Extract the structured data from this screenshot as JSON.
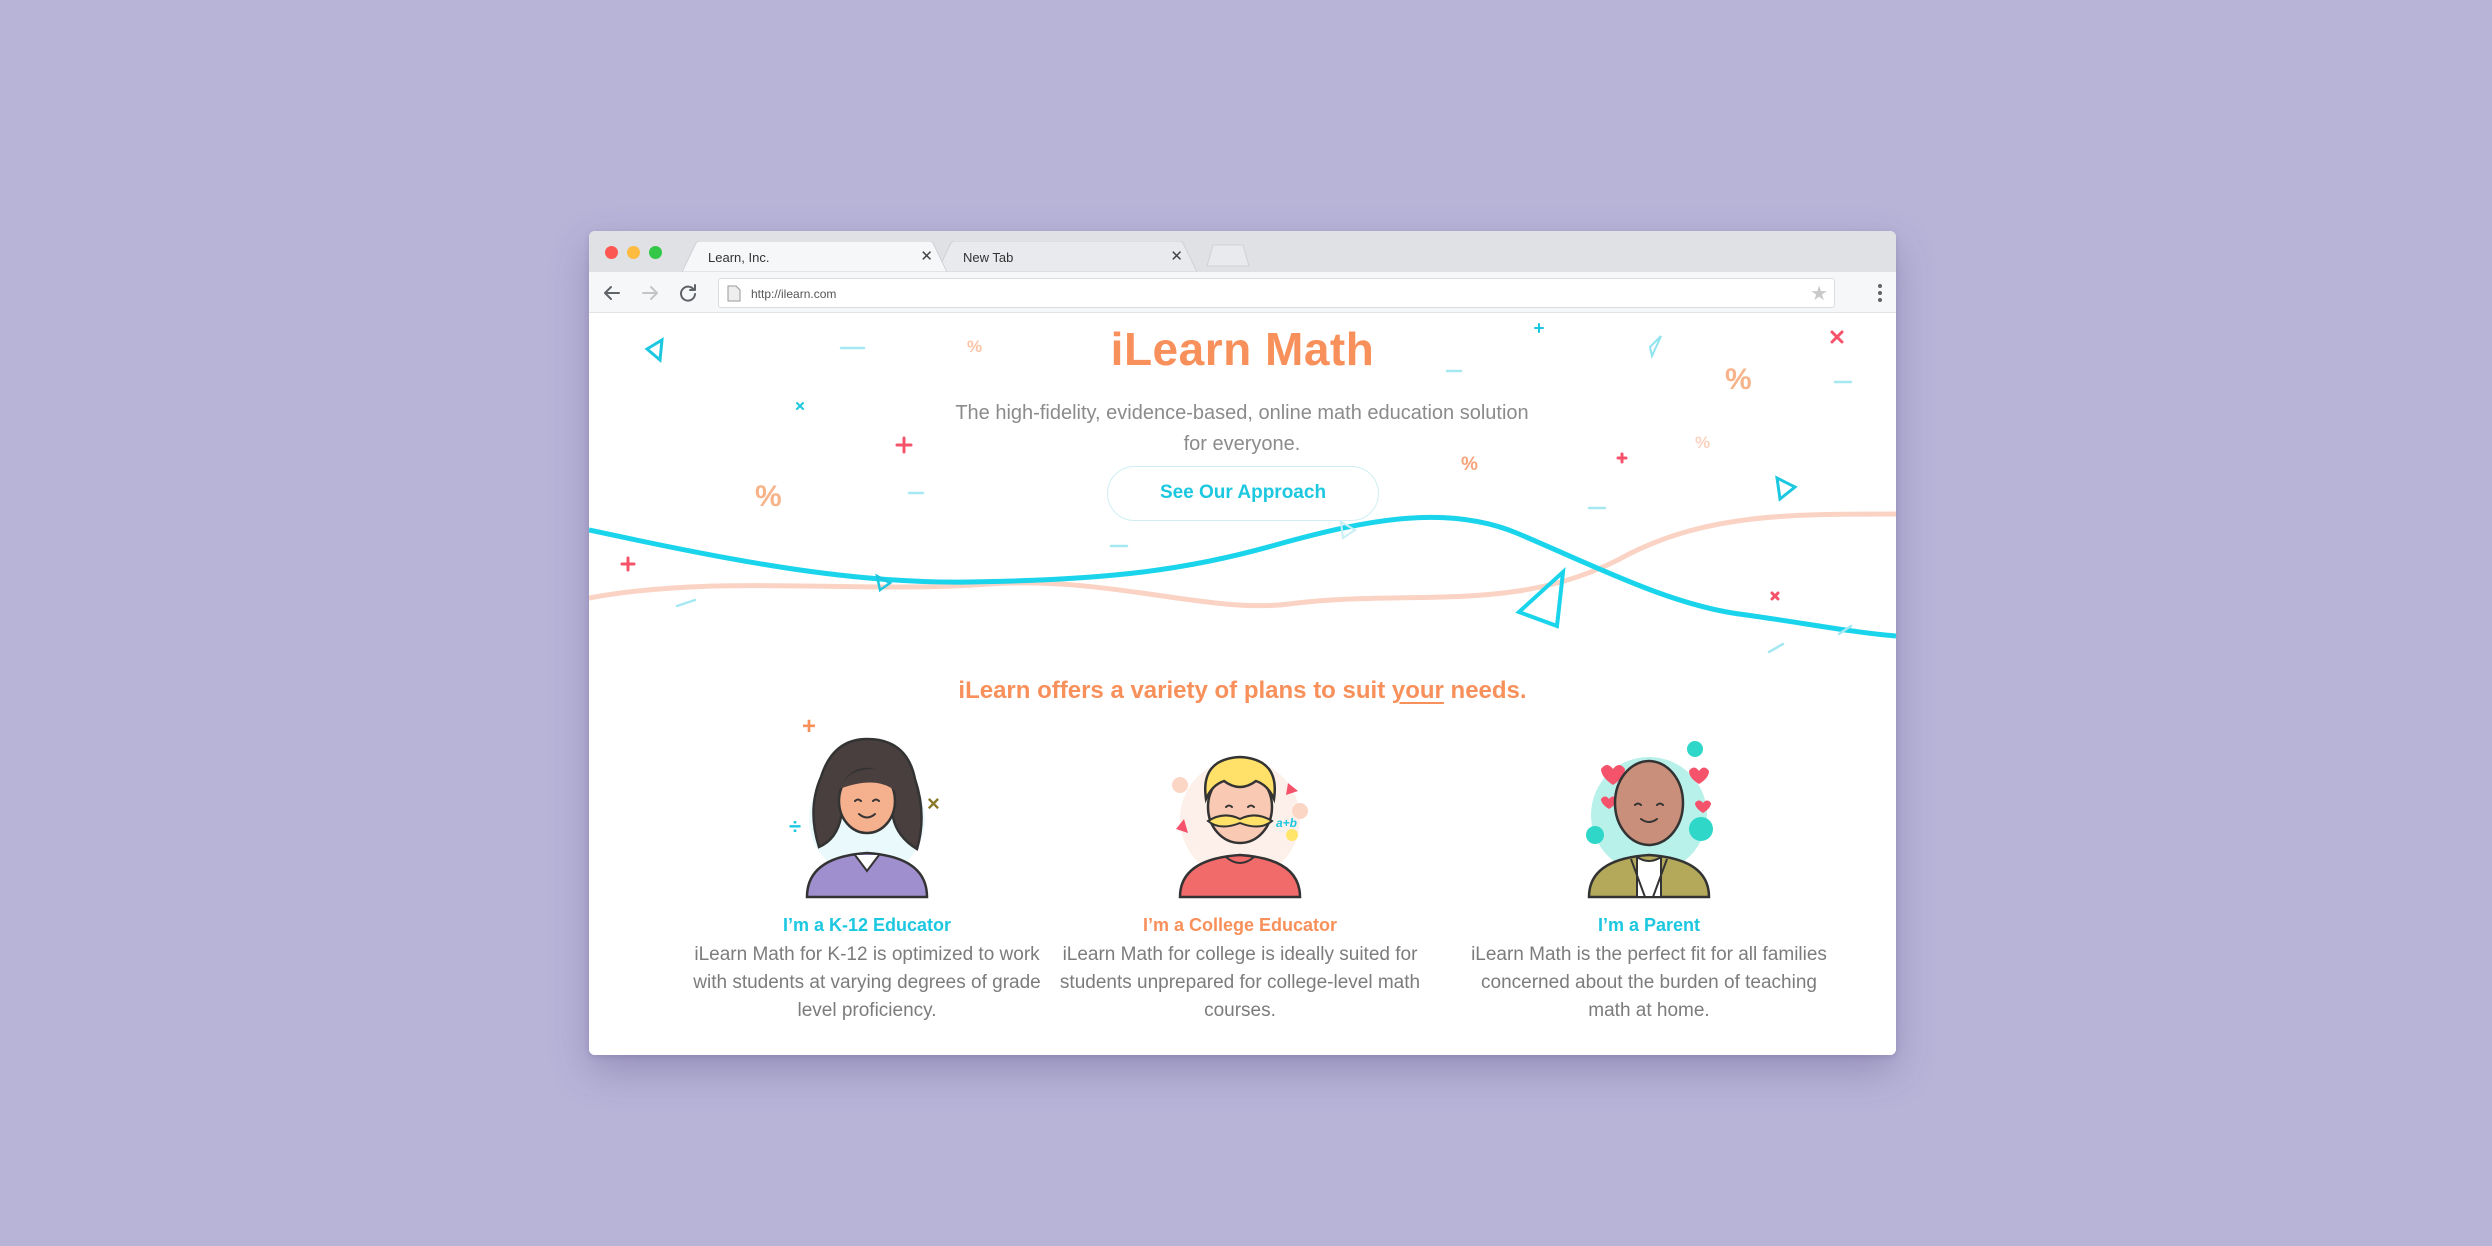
{
  "browser": {
    "tabs": [
      {
        "label": "Learn, Inc.",
        "close": "✕"
      },
      {
        "label": "New Tab",
        "close": "✕"
      }
    ],
    "url": "http://ilearn.com",
    "bookmark_icon": "★"
  },
  "hero": {
    "title": "iLearn Math",
    "subtitle": "The high-fidelity, evidence-based, online math education solution for everyone.",
    "cta_label": "See Our Approach"
  },
  "plans": {
    "heading_before": "iLearn offers a variety of plans to suit ",
    "heading_emphasis": "your",
    "heading_after": " needs.",
    "cards": [
      {
        "title": "I’m a K-12 Educator",
        "description": "iLearn Math for K-12 is optimized to work with students at varying degrees of grade level proficiency.",
        "icon": "k12-educator-avatar"
      },
      {
        "title": "I’m a College Educator",
        "description": "iLearn Math for college is ideally suited for students unprepared for college-level math courses.",
        "icon": "college-educator-avatar"
      },
      {
        "title": "I’m a Parent",
        "description": "iLearn Math is the perfect fit for all families concerned about the burden of teaching math at home.",
        "icon": "parent-avatar"
      }
    ]
  },
  "colors": {
    "background": "#b8b4d8",
    "accent_orange": "#f7905a",
    "accent_cyan": "#1cc7e0",
    "accent_pink": "#f5536b"
  },
  "decor": {
    "percent": "%",
    "plus": "+",
    "times": "×",
    "divide": "÷"
  }
}
